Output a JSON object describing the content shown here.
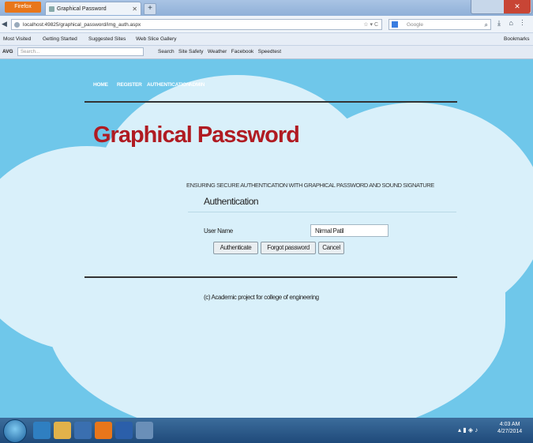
{
  "browser": {
    "menu_button": "Firefox",
    "tab_title": "Graphical Password Authentication",
    "new_tab": "+",
    "window_title": "",
    "url": "localhost:49825/graphical_password/img_auth.aspx",
    "search_engine": "Google",
    "bookmarks": [
      "Most Visited",
      "Getting Started",
      "Suggested Sites",
      "Web Slice Gallery"
    ],
    "bookmarks_right": "Bookmarks",
    "avg_label": "AVG",
    "avg_search_placeholder": "Search...",
    "avg_items": [
      "Search",
      "Site Safety",
      "Weather",
      "Facebook",
      "Speedtest"
    ]
  },
  "site": {
    "menu": [
      "HOME",
      "REGISTER",
      "AUTHENTICATION",
      "ADMIN"
    ],
    "title": "Graphical Password",
    "tagline": "ENSURING SECURE AUTHENTICATION WITH GRAPHICAL PASSWORD AND SOUND SIGNATURE",
    "section_heading": "Authentication",
    "username_label": "User Name",
    "username_value": "Nirmal Patil",
    "buttons": {
      "authenticate": "Authenticate",
      "forgot": "Forgot password",
      "cancel": "Cancel"
    },
    "footer": "(c) Academic project for college of engineering"
  },
  "taskbar": {
    "clock_time": "4:03 AM",
    "clock_date": "4/27/2014"
  },
  "colors": {
    "page_bg": "#6fc7ea",
    "cloud": "#d9f0fa",
    "title_red": "#b01b22",
    "firefox_orange": "#e8761a"
  }
}
